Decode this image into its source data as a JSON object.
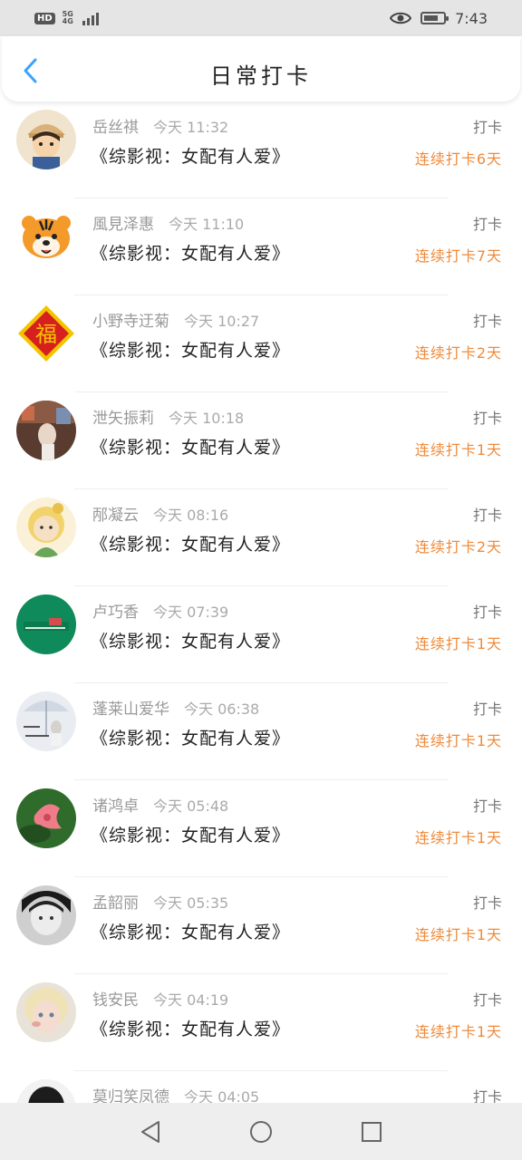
{
  "status_bar": {
    "hd": "HD",
    "network": "5G",
    "network_sub": "4G",
    "time": "7:43",
    "battery_level": 0.75,
    "icons": [
      "eye-icon",
      "battery-icon",
      "signal-icon"
    ]
  },
  "header": {
    "title": "日常打卡",
    "back_icon": "chevron-left-icon",
    "accent_color": "#3aa3ff"
  },
  "entries": [
    {
      "name": "岳丝祺",
      "time": "今天 11:32",
      "book": "《综影视：女配有人爱》",
      "action": "打卡",
      "streak": "连续打卡6天",
      "avatar": "cartoon-boy-avatar"
    },
    {
      "name": "風見泽惠",
      "time": "今天 11:10",
      "book": "《综影视：女配有人爱》",
      "action": "打卡",
      "streak": "连续打卡7天",
      "avatar": "tiger-avatar"
    },
    {
      "name": "小野寺迂菊",
      "time": "今天 10:27",
      "book": "《综影视：女配有人爱》",
      "action": "打卡",
      "streak": "连续打卡2天",
      "avatar": "fu-avatar"
    },
    {
      "name": "泄矢振莉",
      "time": "今天 10:18",
      "book": "《综影视：女配有人爱》",
      "action": "打卡",
      "streak": "连续打卡1天",
      "avatar": "photo-avatar"
    },
    {
      "name": "邴凝云",
      "time": "今天 08:16",
      "book": "《综影视：女配有人爱》",
      "action": "打卡",
      "streak": "连续打卡2天",
      "avatar": "cartoon-girl-avatar"
    },
    {
      "name": "卢巧香",
      "time": "今天 07:39",
      "book": "《综影视：女配有人爱》",
      "action": "打卡",
      "streak": "连续打卡1天",
      "avatar": "green-logo-avatar"
    },
    {
      "name": "蓬莱山爱华",
      "time": "今天 06:38",
      "book": "《综影视：女配有人爱》",
      "action": "打卡",
      "streak": "连续打卡1天",
      "avatar": "umbrella-avatar"
    },
    {
      "name": "诸鸿卓",
      "time": "今天 05:48",
      "book": "《综影视：女配有人爱》",
      "action": "打卡",
      "streak": "连续打卡1天",
      "avatar": "flower-avatar"
    },
    {
      "name": "孟韶丽",
      "time": "今天 05:35",
      "book": "《综影视：女配有人爱》",
      "action": "打卡",
      "streak": "连续打卡1天",
      "avatar": "bw-portrait-avatar"
    },
    {
      "name": "钱安民",
      "time": "今天 04:19",
      "book": "《综影视：女配有人爱》",
      "action": "打卡",
      "streak": "连续打卡1天",
      "avatar": "blonde-child-avatar"
    },
    {
      "name": "莫归笑凤德",
      "time": "今天 04:05",
      "book": "",
      "action": "打卡",
      "streak": "",
      "avatar": "dark-hair-avatar"
    }
  ],
  "nav": {
    "back": "triangle-back-icon",
    "home": "circle-home-icon",
    "recent": "square-recents-icon"
  }
}
